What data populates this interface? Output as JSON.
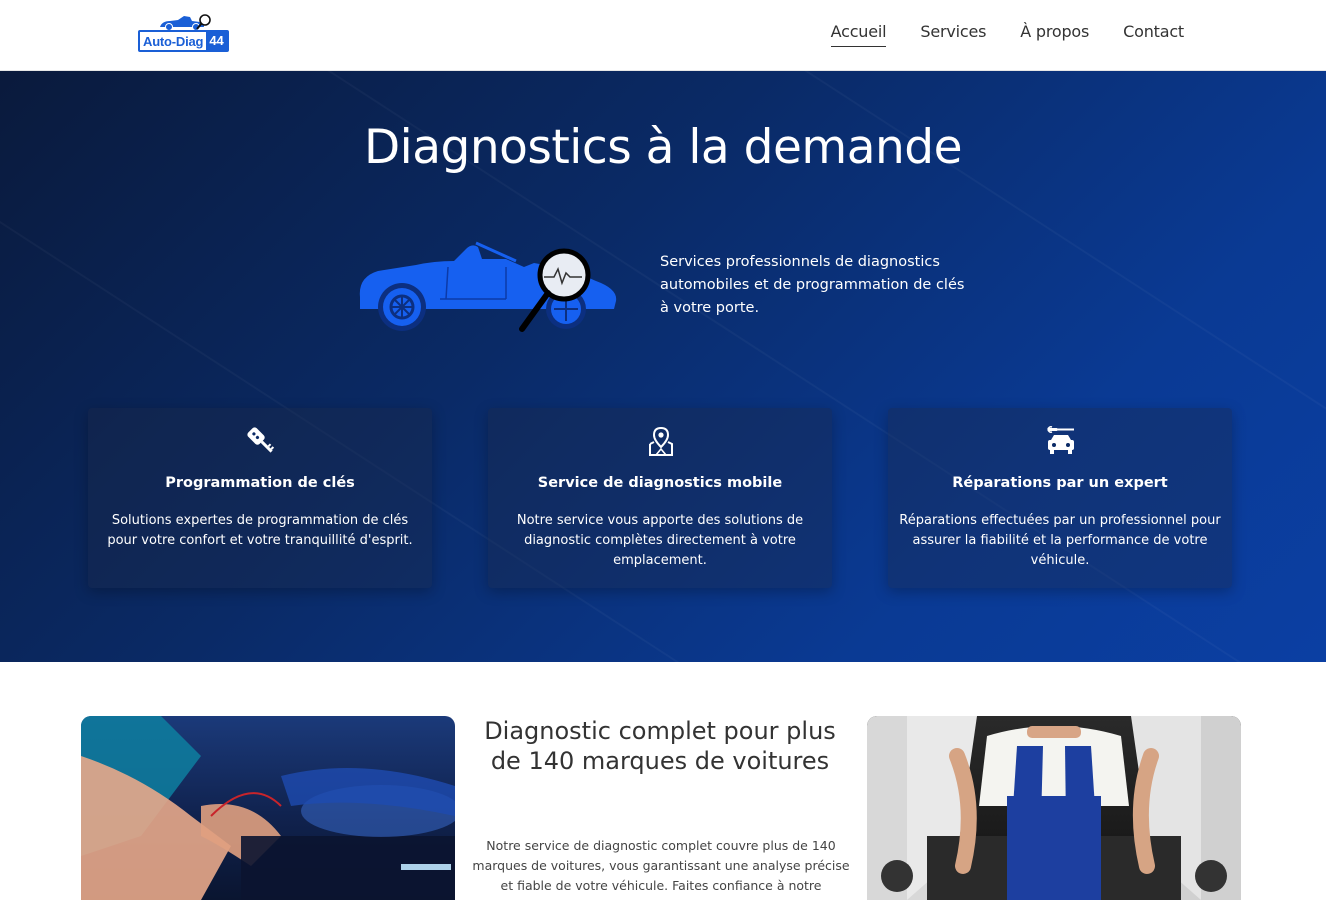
{
  "header": {
    "logo": {
      "text": "Auto-Diag",
      "number": "44",
      "brand_color": "#1a5fd6"
    },
    "nav": [
      {
        "label": "Accueil",
        "active": true
      },
      {
        "label": "Services",
        "active": false
      },
      {
        "label": "À propos",
        "active": false
      },
      {
        "label": "Contact",
        "active": false
      }
    ]
  },
  "hero": {
    "title": "Diagnostics à la demande",
    "description": "Services professionnels de diagnostics automobiles et de programmation de clés à votre porte.",
    "illustration": "car-magnifier-icon",
    "cards": [
      {
        "icon": "car-key-icon",
        "title": "Programmation de clés",
        "text": "Solutions expertes de programmation de clés pour votre confort et votre tranquillité d'esprit."
      },
      {
        "icon": "map-location-icon",
        "title": "Service de diagnostics mobile",
        "text": "Notre service vous apporte des solutions de diagnostic complètes directement à votre emplacement."
      },
      {
        "icon": "car-repair-icon",
        "title": "Réparations par un expert",
        "text": "Réparations effectuées par un professionnel pour assurer la fiabilité et la performance de votre véhicule."
      }
    ],
    "colors": {
      "gradient_start": "#0a1a3c",
      "gradient_end": "#0b3fa3",
      "accent": "#1a5fd6"
    }
  },
  "section2": {
    "title": "Diagnostic complet pour plus de 140 marques de voitures",
    "text": "Notre service de diagnostic complet couvre plus de 140 marques de voitures, vous garantissant une analyse précise et fiable de votre véhicule. Faites confiance à notre"
  }
}
